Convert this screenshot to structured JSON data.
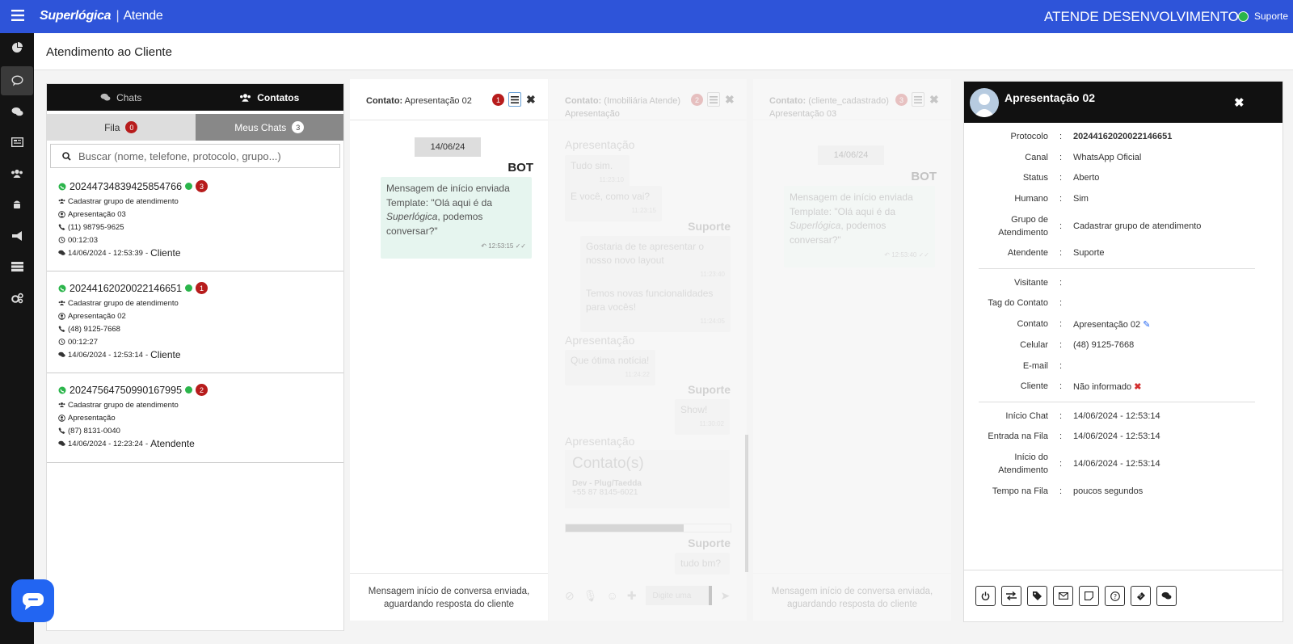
{
  "topbar": {
    "brand": "Superlógica",
    "brand_sep": "|",
    "product": "Atende",
    "env_name": "ATENDE DESENVOLVIMENTO",
    "user": "Suporte"
  },
  "header": {
    "title": "Atendimento ao Cliente"
  },
  "left_panel": {
    "tabs": [
      {
        "label": "Chats",
        "icon": "comments-icon"
      },
      {
        "label": "Contatos",
        "icon": "users-icon"
      }
    ],
    "subtabs": [
      {
        "label": "Fila",
        "count": "0"
      },
      {
        "label": "Meus Chats",
        "count": "3"
      }
    ],
    "search_placeholder": "Buscar (nome, telefone, protocolo, grupo...)",
    "items": [
      {
        "protocol": "20244734839425854766",
        "badge": "3",
        "group": "Cadastrar grupo de atendimento",
        "contact": "Apresentação 03",
        "phone": "(11) 98795-9625",
        "duration": "00:12:03",
        "last_time": "14/06/2024 - 12:53:39",
        "last_by": "Cliente"
      },
      {
        "protocol": "20244162020022146651",
        "badge": "1",
        "group": "Cadastrar grupo de atendimento",
        "contact": "Apresentação 02",
        "phone": "(48) 9125-7668",
        "duration": "00:12:27",
        "last_time": "14/06/2024 - 12:53:14",
        "last_by": "Cliente"
      },
      {
        "protocol": "20247564750990167995",
        "badge": "2",
        "group": "Cadastrar grupo de atendimento",
        "contact": "Apresentação",
        "phone": "(87) 8131-0040",
        "last_time": "14/06/2024 - 12:23:24",
        "last_by": "Atendente"
      }
    ],
    "last_sep": "-"
  },
  "chat1": {
    "contact_label": "Contato:",
    "contact_name": "Apresentação 02",
    "badge": "1",
    "date": "14/06/24",
    "sender": "BOT",
    "message_line1": "Mensagem de início enviada",
    "message_line2": "Template: \"Olá aqui é da",
    "message_em": "Superlógica",
    "message_line3": ", podemos conversar?\"",
    "message_time": "12:53:15",
    "footer": "Mensagem início de conversa enviada, aguardando resposta do cliente"
  },
  "chat2": {
    "contact_label": "Contato:",
    "contact_sub": "(Imobiliária Atende)",
    "contact_name": "Apresentação",
    "badge": "2",
    "m1_sender": "Apresentação",
    "m1a": "Tudo sim.",
    "m1a_time": "11:23:10",
    "m1b": "E você, como vai?",
    "m1b_time": "11:23:15",
    "m2_sender": "Suporte",
    "m2a": "Gostaria de te apresentar o nosso novo layout",
    "m2a_time": "11:23:40",
    "m2b": "Temos novas funcionalidades para vocês!",
    "m2b_time": "11:24:05",
    "m3_sender": "Apresentação",
    "m3a": "Que ótima notícia!",
    "m3a_time": "11:24:22",
    "m4_sender": "Suporte",
    "m4a": "Show!",
    "m4a_time": "11:30:02",
    "m5_sender": "Apresentação",
    "card_title": "Contato(s)",
    "card_name": "Dev - Plug/Taedda",
    "card_phone": "+55 87 8145-6021",
    "m6_sender": "Suporte",
    "m6a": "tudo bm?",
    "input_placeholder": "Digite uma"
  },
  "chat3": {
    "contact_label": "Contato:",
    "contact_sub": "(cliente_cadastrado)",
    "contact_name": "Apresentação 03",
    "badge": "3",
    "date": "14/06/24",
    "sender": "BOT",
    "message_line1": "Mensagem de início enviada",
    "message_line2": "Template: \"Olá aqui é da",
    "message_em": "Superlógica",
    "message_line3": ", podemos conversar?\"",
    "message_time": "12:53:40",
    "footer": "Mensagem início de conversa enviada, aguardando resposta do cliente"
  },
  "details": {
    "name": "Apresentação 02",
    "rows": [
      {
        "label": "Protocolo",
        "value": "20244162020022146651"
      },
      {
        "label": "Canal",
        "value": "WhatsApp Oficial"
      },
      {
        "label": "Status",
        "value": "Aberto"
      },
      {
        "label": "Humano",
        "value": "Sim"
      },
      {
        "label": "Grupo de Atendimento",
        "value": "Cadastrar grupo de atendimento"
      },
      {
        "label": "Atendente",
        "value": "Suporte"
      },
      {
        "label": "Visitante",
        "value": ""
      },
      {
        "label": "Tag do Contato",
        "value": ""
      },
      {
        "label": "Contato",
        "value": "Apresentação 02"
      },
      {
        "label": "Celular",
        "value": "(48) 9125-7668"
      },
      {
        "label": "E-mail",
        "value": ""
      },
      {
        "label": "Cliente",
        "value": "Não informado"
      },
      {
        "label": "Início Chat",
        "value": "14/06/2024 - 12:53:14"
      },
      {
        "label": "Entrada na Fila",
        "value": "14/06/2024 - 12:53:14"
      },
      {
        "label": "Início do Atendimento",
        "value": "14/06/2024 - 12:53:14"
      },
      {
        "label": "Tempo na Fila",
        "value": "poucos segundos"
      }
    ],
    "colon": ":",
    "actions": [
      "power-icon",
      "transfer-icon",
      "tag-icon",
      "envelope-icon",
      "note-icon",
      "help-icon",
      "ticket-icon",
      "chat-icon"
    ]
  },
  "colors": {
    "topbar": "#2e54d9",
    "sidebar": "#141414",
    "online": "#2bb54b",
    "badge": "#b71c1c",
    "bubble": "#e6f5ef",
    "fab": "#2265f2"
  }
}
